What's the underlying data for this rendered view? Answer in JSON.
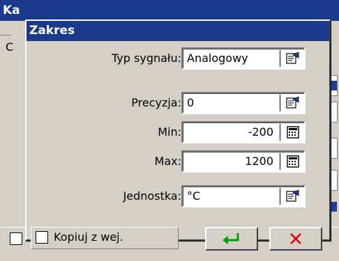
{
  "background_window": {
    "title_fragment": "Ka",
    "left_fragment": "C"
  },
  "dialog": {
    "title": "Zakres",
    "fields": [
      {
        "label": "Typ sygnału:",
        "value": "Analogowy",
        "button_icon": "list-select-icon"
      },
      {
        "label": "Precyzja:",
        "value": "0",
        "button_icon": "list-select-icon"
      },
      {
        "label": "Min:",
        "value": "-200",
        "button_icon": "calculator-icon"
      },
      {
        "label": "Max:",
        "value": "1200",
        "button_icon": "calculator-icon"
      },
      {
        "label": "Jednostka:",
        "value": "°C",
        "button_icon": "list-select-icon"
      }
    ],
    "copy_checkbox": {
      "label": "Kopiuj z wej.",
      "checked": false
    },
    "ok_button": {
      "icon": "enter-arrow-icon",
      "color": "#00a000"
    },
    "cancel_button": {
      "icon": "close-x-icon",
      "color": "#e00000"
    }
  },
  "colors": {
    "titlebar": "#1c3a8c",
    "surface": "#d4d0c8"
  }
}
